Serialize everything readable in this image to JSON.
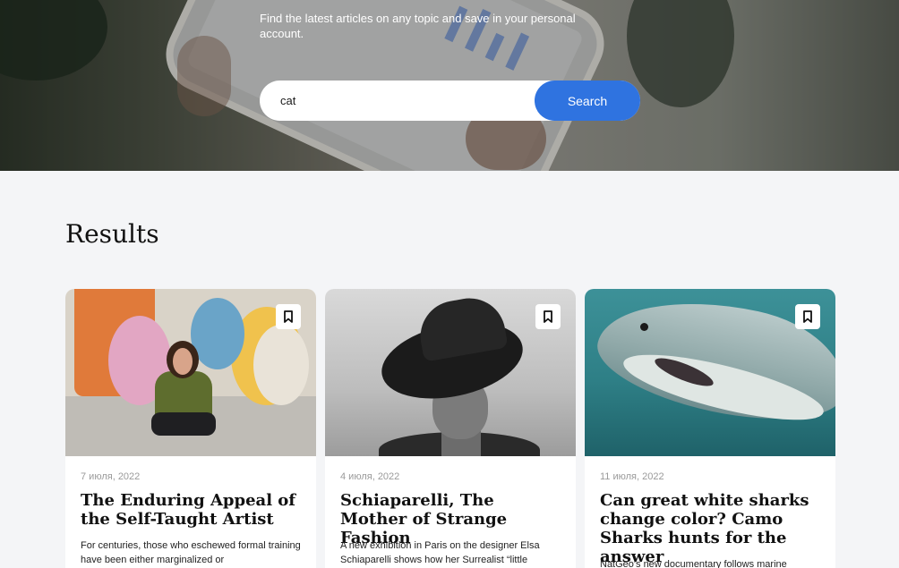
{
  "hero": {
    "tagline": "Find the latest articles on any topic and save in your personal account.",
    "search": {
      "value": "cat",
      "button_label": "Search"
    }
  },
  "results": {
    "title": "Results",
    "cards": [
      {
        "date": "7 июля, 2022",
        "title": "The Enduring Appeal of the Self-Taught Artist",
        "text": "For centuries, those who eschewed formal training have been either marginalized or"
      },
      {
        "date": "4 июля, 2022",
        "title": "Schiaparelli, The Mother of Strange Fashion",
        "text": "A new exhibition in Paris on the designer Elsa Schiaparelli shows how her Surrealist “little"
      },
      {
        "date": "11 июля, 2022",
        "title": "Can great white sharks change color? Camo Sharks hunts for the answer",
        "text": "NatGeo's new documentary follows marine"
      }
    ]
  },
  "icons": {
    "bookmark": "bookmark-icon"
  },
  "colors": {
    "accent": "#2f73e0",
    "background": "#f4f5f7"
  }
}
